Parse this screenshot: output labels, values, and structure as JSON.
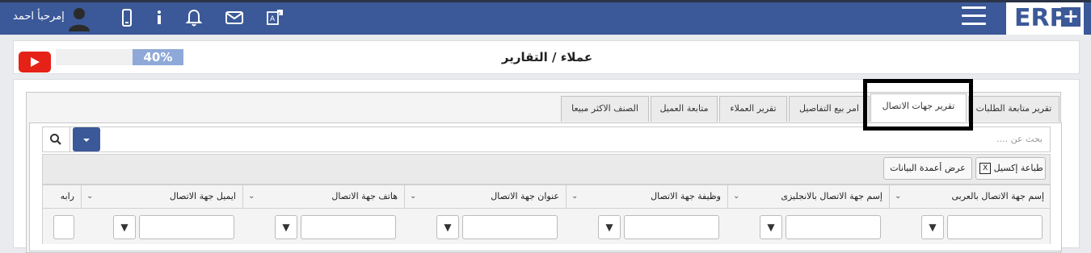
{
  "topbar": {
    "logo_text": "ERP",
    "logo_plus": "+",
    "user_name": "إمرحبأ احمد",
    "icons": [
      "user-avatar-icon",
      "mobile-icon",
      "info-icon",
      "bell-icon",
      "mail-icon",
      "translate-icon",
      "menu-icon"
    ]
  },
  "header": {
    "page_title": "عملاء / التقارير",
    "progress_value": 40,
    "progress_label": "40%"
  },
  "tabs": [
    {
      "label": "تقرير متابعة الطلبات"
    },
    {
      "label": "تقرير جهات الاتصال",
      "active": true
    },
    {
      "label": "امر بيع التفاصيل"
    },
    {
      "label": "تقرير العملاء"
    },
    {
      "label": "متابعة العميل"
    },
    {
      "label": "الصنف الاكثر مبيعا"
    }
  ],
  "search": {
    "placeholder": "بحث عن ...."
  },
  "toolbar": {
    "excel_label": "طباعة إكسيل",
    "columns_label": "عرض أعمدة البيانات"
  },
  "columns": [
    {
      "label": "إسم جهة الاتصال بالعربى"
    },
    {
      "label": "إسم جهة الاتصال بالانجليزى"
    },
    {
      "label": "وظيفة جهة الاتصال"
    },
    {
      "label": "عنوان جهة الاتصال"
    },
    {
      "label": "هاتف جهة الاتصال"
    },
    {
      "label": "ايميل جهة الاتصال"
    },
    {
      "label": "رابه"
    }
  ],
  "colors": {
    "brand": "#3b5998",
    "progress": "#8ea9d8",
    "youtube": "#e62117"
  }
}
